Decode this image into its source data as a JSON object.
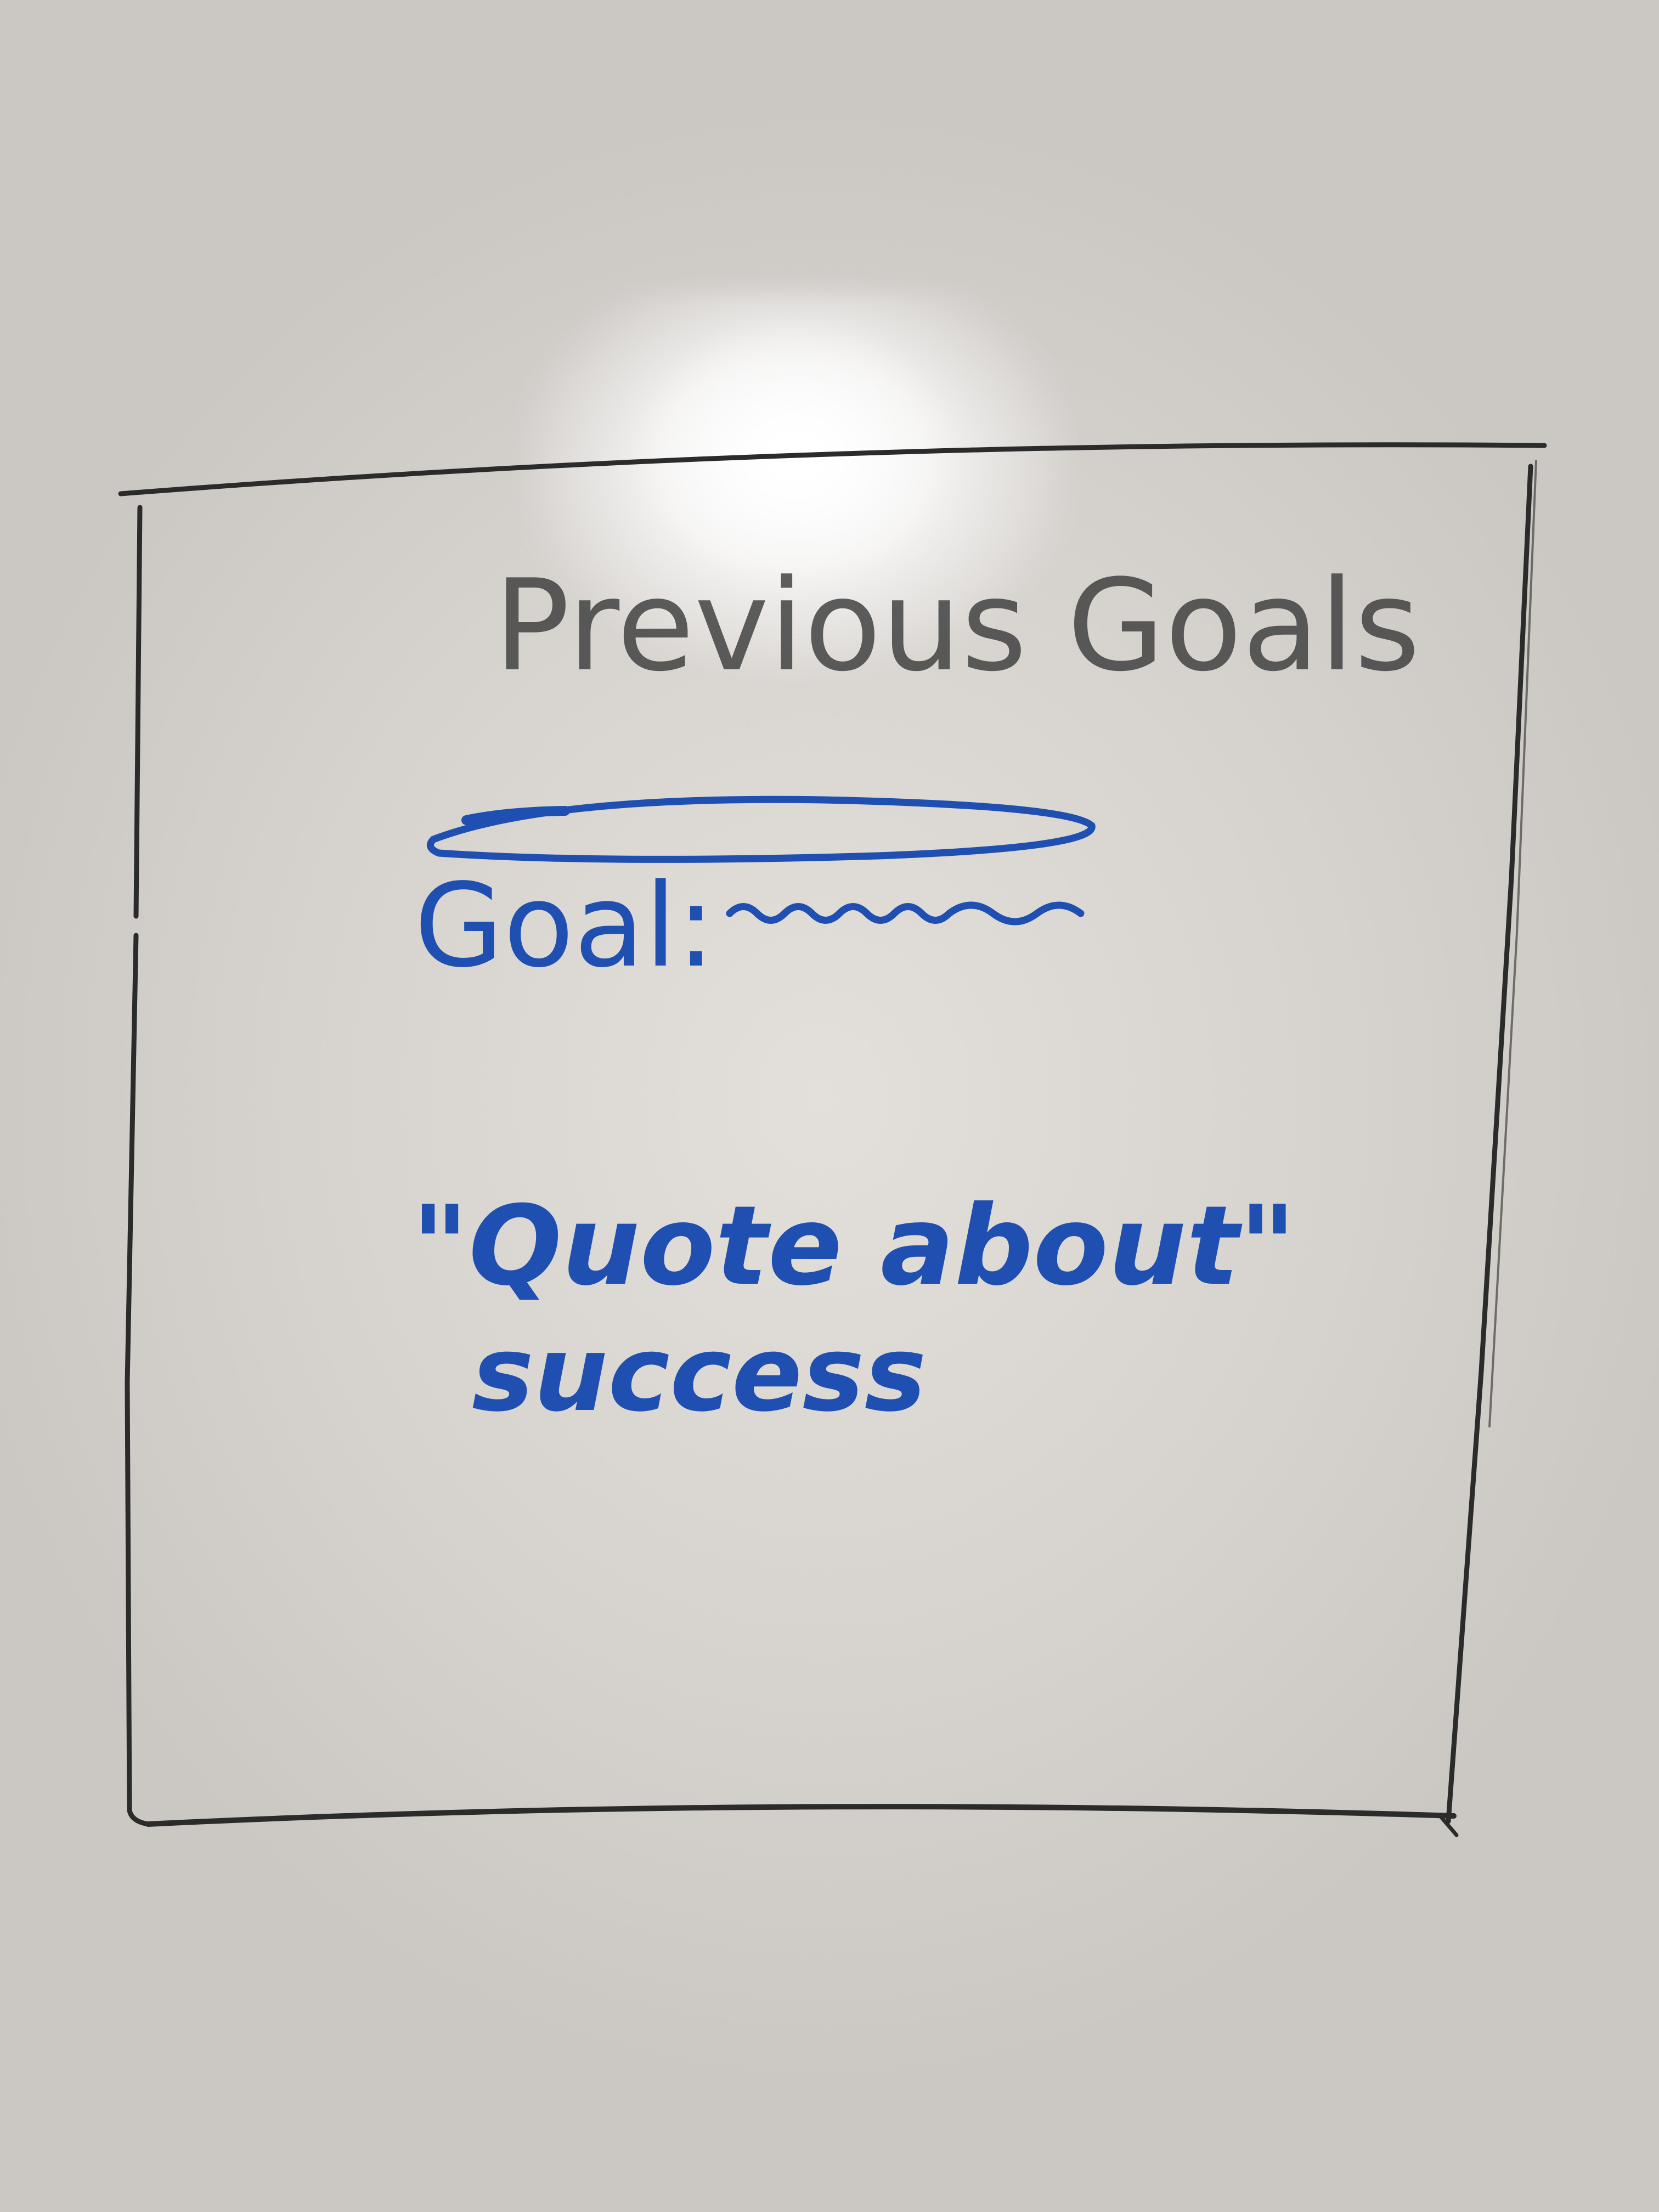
{
  "board": {
    "title": "Previous Goals",
    "goal_label": "Goal:",
    "quote_line1": "\"Quote about\"",
    "quote_line2": "success"
  },
  "colors": {
    "board_surface": "#dcd8d4",
    "black_marker": "#2b2b2b",
    "blue_marker": "#1f4fb0"
  }
}
